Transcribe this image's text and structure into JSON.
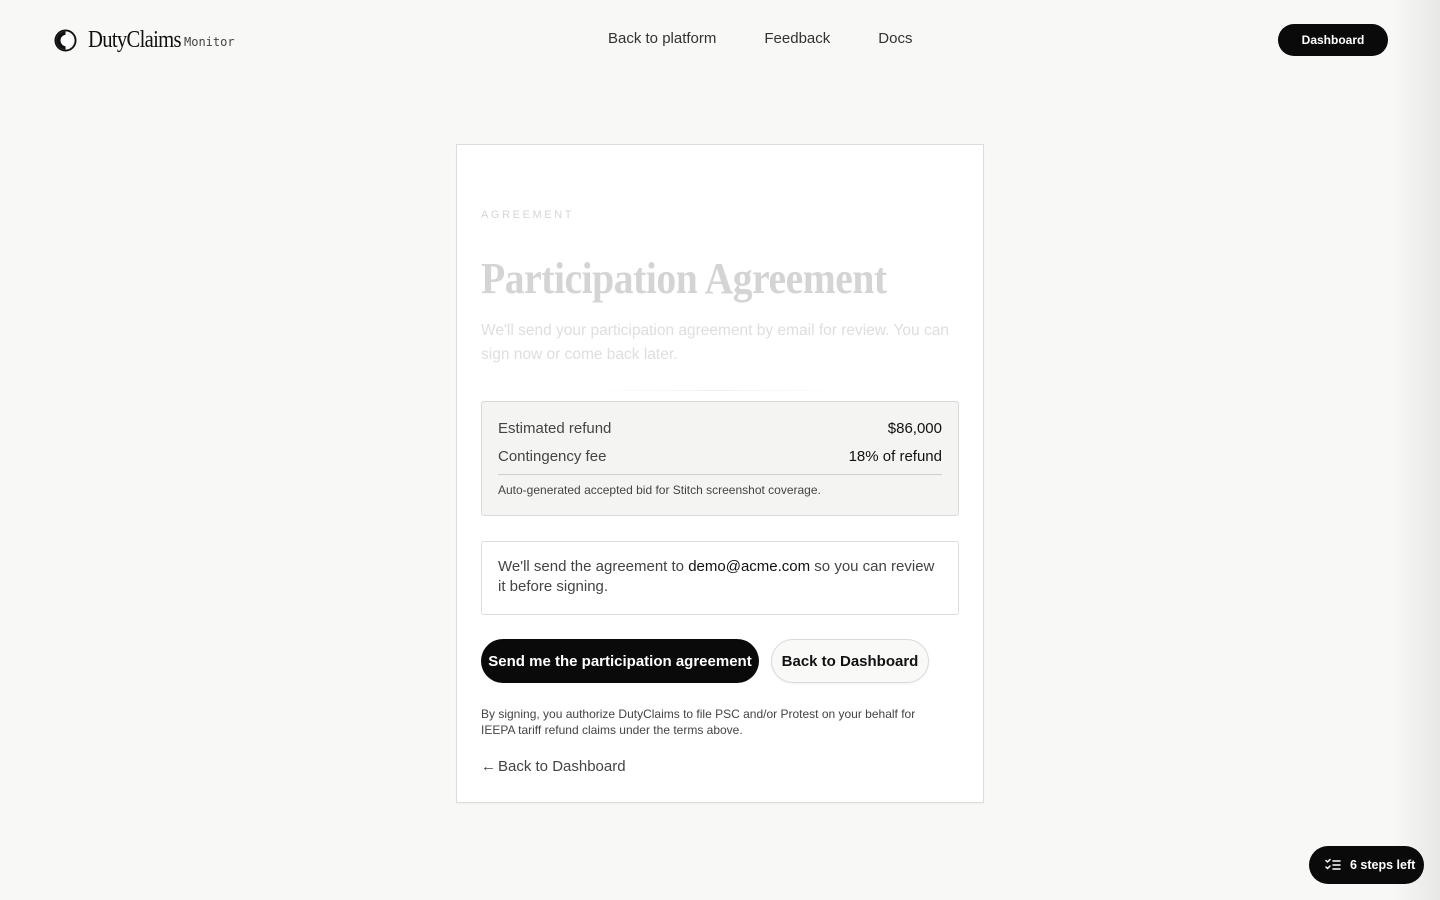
{
  "brand": {
    "name": "DutyClaims",
    "tag": "Monitor",
    "logo_icon": "half-circle-logo-icon"
  },
  "nav": {
    "items": [
      {
        "label": "Back to platform"
      },
      {
        "label": "Feedback"
      },
      {
        "label": "Docs"
      }
    ],
    "dashboard_label": "Dashboard"
  },
  "card": {
    "eyebrow": "AGREEMENT",
    "title": "Participation Agreement",
    "intro": "We'll send your participation agreement by email for review. You can sign now or come back later.",
    "summary": {
      "refund_label": "Estimated refund",
      "refund_value": "$86,000",
      "fee_label": "Contingency fee",
      "fee_value": "18% of refund",
      "note": "Auto-generated accepted bid for Stitch screenshot coverage."
    },
    "email_notice": {
      "prefix": "We'll send the agreement to ",
      "email": "demo@acme.com",
      "suffix": " so you can review it before signing."
    },
    "primary_button": "Send me the participation agreement",
    "secondary_button": "Back to Dashboard",
    "legal": "By signing, you authorize DutyClaims to file PSC and/or Protest on your behalf for IEEPA tariff refund claims under the terms above.",
    "back_link_arrow": "←",
    "back_link": "Back to Dashboard"
  },
  "steps_pill": {
    "label": "6 steps left",
    "icon": "checklist-icon"
  },
  "colors": {
    "background": "#f8f8f6",
    "primary": "#0a0a0a",
    "card": "#ffffff",
    "muted_text": "#d4d4d4"
  }
}
